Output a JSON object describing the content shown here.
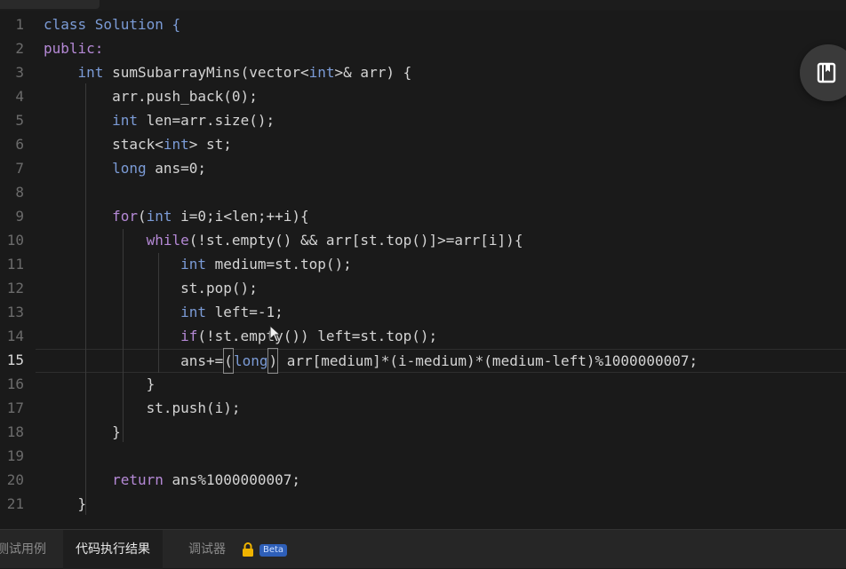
{
  "editor": {
    "active_line": "15",
    "line_numbers": [
      "1",
      "2",
      "3",
      "4",
      "5",
      "6",
      "7",
      "8",
      "9",
      "10",
      "11",
      "12",
      "13",
      "14",
      "15",
      "16",
      "17",
      "18",
      "19",
      "20",
      "21"
    ],
    "lines": [
      [
        {
          "t": "class Solution {",
          "c": "kw"
        }
      ],
      [
        {
          "t": "public:",
          "c": "kw2"
        }
      ],
      [
        {
          "t": "    ",
          "c": ""
        },
        {
          "t": "int",
          "c": "kw"
        },
        {
          "t": " sumSubarrayMins(vector<",
          "c": ""
        },
        {
          "t": "int",
          "c": "kw"
        },
        {
          "t": ">& arr) {",
          "c": ""
        }
      ],
      [
        {
          "t": "        arr.push_back(0);",
          "c": ""
        }
      ],
      [
        {
          "t": "        ",
          "c": ""
        },
        {
          "t": "int",
          "c": "kw"
        },
        {
          "t": " len=arr.size();",
          "c": ""
        }
      ],
      [
        {
          "t": "        stack<",
          "c": ""
        },
        {
          "t": "int",
          "c": "kw"
        },
        {
          "t": "> st;",
          "c": ""
        }
      ],
      [
        {
          "t": "        ",
          "c": ""
        },
        {
          "t": "long",
          "c": "kw"
        },
        {
          "t": " ans=0;",
          "c": ""
        }
      ],
      [
        {
          "t": "",
          "c": ""
        }
      ],
      [
        {
          "t": "        ",
          "c": ""
        },
        {
          "t": "for",
          "c": "kw2"
        },
        {
          "t": "(",
          "c": ""
        },
        {
          "t": "int",
          "c": "kw"
        },
        {
          "t": " i=0;i<len;++i){",
          "c": ""
        }
      ],
      [
        {
          "t": "            ",
          "c": ""
        },
        {
          "t": "while",
          "c": "kw2"
        },
        {
          "t": "(!st.empty() && arr[st.top()]>=arr[i]){",
          "c": ""
        }
      ],
      [
        {
          "t": "                ",
          "c": ""
        },
        {
          "t": "int",
          "c": "kw"
        },
        {
          "t": " medium=st.top();",
          "c": ""
        }
      ],
      [
        {
          "t": "                st.pop();",
          "c": ""
        }
      ],
      [
        {
          "t": "                ",
          "c": ""
        },
        {
          "t": "int",
          "c": "kw"
        },
        {
          "t": " left=-1;",
          "c": ""
        }
      ],
      [
        {
          "t": "                ",
          "c": ""
        },
        {
          "t": "if",
          "c": "kw2"
        },
        {
          "t": "(!st.empty()) left=st.top();",
          "c": ""
        }
      ],
      [
        {
          "t": "                ans+=",
          "c": ""
        },
        {
          "t": "(",
          "c": "br"
        },
        {
          "t": "long",
          "c": "kw"
        },
        {
          "t": ")",
          "c": "br"
        },
        {
          "t": " arr[medium]*(i-medium)*(medium-left)%1000000007;",
          "c": ""
        }
      ],
      [
        {
          "t": "            }",
          "c": ""
        }
      ],
      [
        {
          "t": "            st.push(i);",
          "c": ""
        }
      ],
      [
        {
          "t": "        }",
          "c": ""
        }
      ],
      [
        {
          "t": "",
          "c": ""
        }
      ],
      [
        {
          "t": "        ",
          "c": ""
        },
        {
          "t": "return",
          "c": "kw2"
        },
        {
          "t": " ans%1000000007;",
          "c": ""
        }
      ],
      [
        {
          "t": "    }",
          "c": ""
        }
      ]
    ]
  },
  "floating_button": {
    "icon": "book-icon"
  },
  "bottom_tabs": {
    "tab1": "测试用例",
    "tab2": "代码执行结果",
    "tab3": "调试器",
    "beta": "Beta",
    "lock_icon": "lock-icon"
  },
  "colors": {
    "keyword_blue": "#7b9bd6",
    "keyword_purple": "#b589d6",
    "text": "#d4d4d4",
    "background": "#1a1a1a",
    "lock": "#f0b400",
    "beta": "#2e5fb8"
  }
}
